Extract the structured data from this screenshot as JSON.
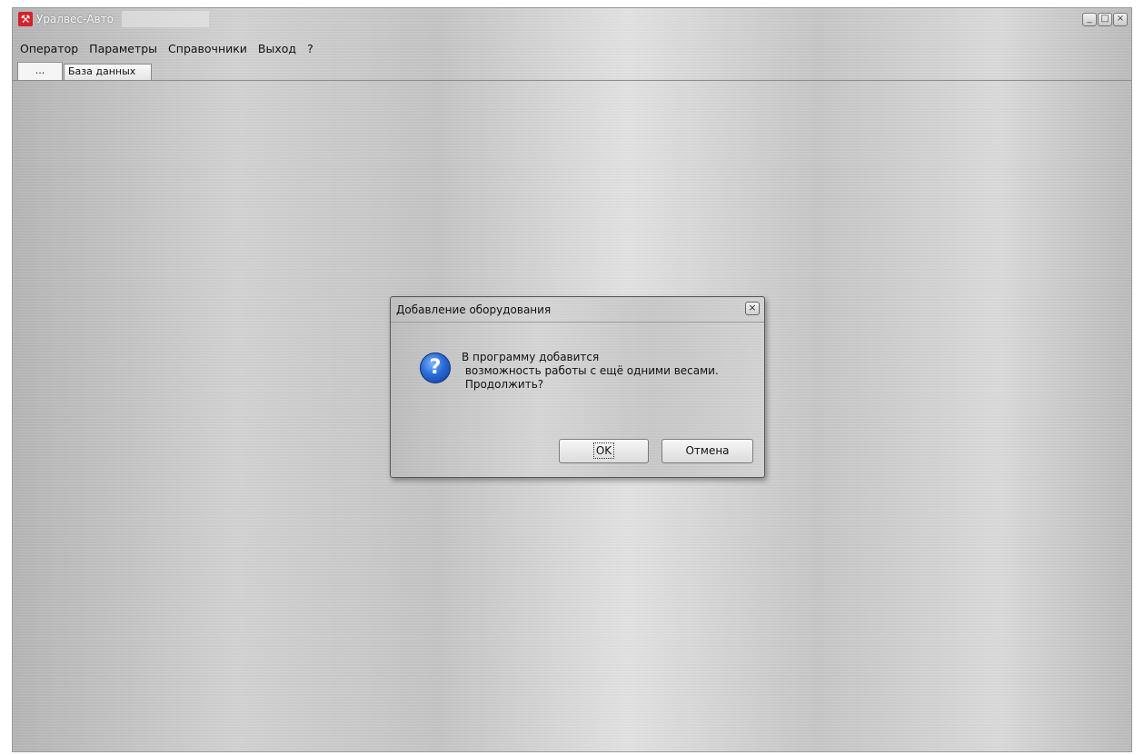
{
  "app": {
    "title": "Уралвес-Авто",
    "icon": "hammers-icon",
    "controls": {
      "minimize": "_",
      "maximize": "□",
      "close": "×"
    }
  },
  "menu": {
    "items": [
      "Оператор",
      "Параметры",
      "Справочники",
      "Выход",
      "?"
    ]
  },
  "tabs": [
    {
      "label": "..."
    },
    {
      "label": "База данных"
    }
  ],
  "dialog": {
    "title": "Добавление оборудования",
    "close_label": "×",
    "icon": "question-icon",
    "icon_glyph": "?",
    "message": "В программу добавится\n возможность работы с ещё одними весами.\n Продолжить?",
    "ok_label": "OK",
    "cancel_label": "Отмена"
  }
}
